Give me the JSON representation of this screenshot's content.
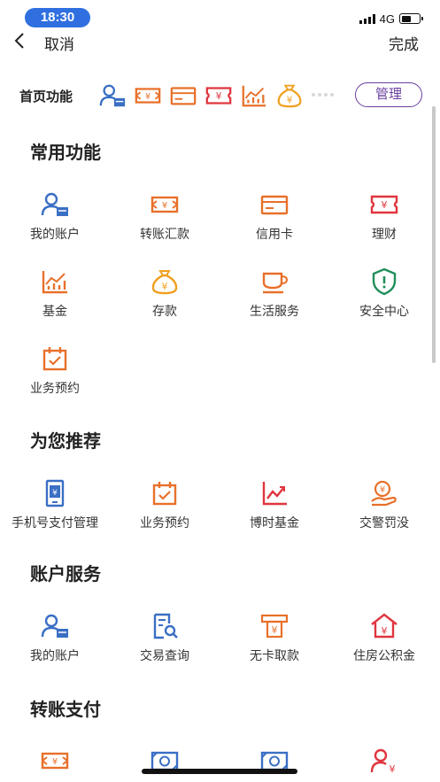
{
  "status": {
    "time": "18:30",
    "network": "4G",
    "battery_level": 0.55
  },
  "nav": {
    "cancel": "取消",
    "done": "完成"
  },
  "home_functions": {
    "label": "首页功能",
    "manage": "管理",
    "icons": [
      "account-icon",
      "transfer-icon",
      "credit-card-icon",
      "finance-icon",
      "fund-chart-icon",
      "deposit-bag-icon"
    ]
  },
  "sections": [
    {
      "title": "常用功能",
      "items": [
        {
          "label": "我的账户",
          "icon": "account-icon"
        },
        {
          "label": "转账汇款",
          "icon": "transfer-icon"
        },
        {
          "label": "信用卡",
          "icon": "credit-card-icon"
        },
        {
          "label": "理财",
          "icon": "finance-icon"
        },
        {
          "label": "基金",
          "icon": "fund-chart-icon"
        },
        {
          "label": "存款",
          "icon": "deposit-bag-icon"
        },
        {
          "label": "生活服务",
          "icon": "coffee-cup-icon"
        },
        {
          "label": "安全中心",
          "icon": "shield-icon"
        },
        {
          "label": "业务预约",
          "icon": "calendar-icon"
        }
      ]
    },
    {
      "title": "为您推荐",
      "items": [
        {
          "label": "手机号支付管理",
          "icon": "phone-pay-icon"
        },
        {
          "label": "业务预约",
          "icon": "calendar-icon"
        },
        {
          "label": "博时基金",
          "icon": "trend-icon"
        },
        {
          "label": "交警罚没",
          "icon": "coin-hand-icon"
        }
      ]
    },
    {
      "title": "账户服务",
      "items": [
        {
          "label": "我的账户",
          "icon": "account-icon"
        },
        {
          "label": "交易查询",
          "icon": "search-doc-icon"
        },
        {
          "label": "无卡取款",
          "icon": "atm-icon"
        },
        {
          "label": "住房公积金",
          "icon": "house-icon"
        }
      ]
    },
    {
      "title": "转账支付",
      "items": [
        {
          "label": "",
          "icon": "transfer-icon"
        },
        {
          "label": "",
          "icon": "money-bill-icon"
        },
        {
          "label": "",
          "icon": "money-bill-icon"
        },
        {
          "label": "",
          "icon": "person-yuan-icon"
        }
      ]
    }
  ],
  "colors": {
    "orange": "#e8702a",
    "blue": "#3a6fc4",
    "red": "#e0353f",
    "purple": "#6a3fa0",
    "green": "#1f8f5a",
    "gold": "#f0a020"
  }
}
